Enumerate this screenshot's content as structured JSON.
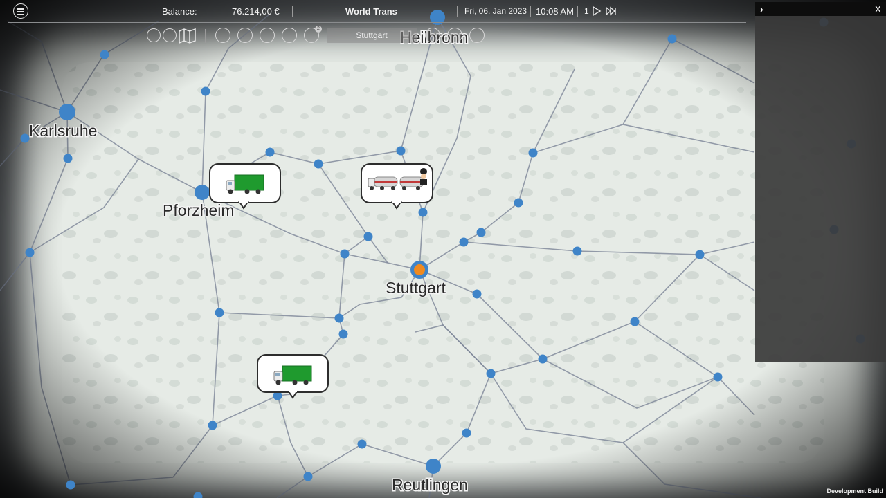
{
  "topbar": {
    "balance_label": "Balance:",
    "balance_value": "76.214,00 €",
    "company_name": "World Trans",
    "date": "Fri, 06. Jan 2023",
    "time": "10:08 AM",
    "speed": "1"
  },
  "toolbar": {
    "icons": [
      "stats-icon",
      "chart-icon",
      "map-icon",
      "finance-icon",
      "staff-icon",
      "bus-icon",
      "contracts-icon",
      "mail-icon",
      "tools-icon",
      "shop-icon",
      "user-icon"
    ],
    "mail_badge": "2",
    "city_selector": "Stuttgart"
  },
  "map": {
    "cities": [
      {
        "name": "Karlsruhe",
        "major": true
      },
      {
        "name": "Pforzheim",
        "major": true
      },
      {
        "name": "Stuttgart",
        "major": true,
        "selected": true
      },
      {
        "name": "Reutlingen",
        "major": true
      },
      {
        "name": "Heilbronn",
        "major": true
      }
    ],
    "vehicles": [
      {
        "type": "box-truck-green"
      },
      {
        "type": "tanker-truck-with-driver"
      },
      {
        "type": "box-truck-green"
      }
    ]
  },
  "side_panel": {
    "expand_icon": "chevron-right-icon",
    "close_label": "X"
  },
  "footer": {
    "dev_build": "Development Build"
  }
}
